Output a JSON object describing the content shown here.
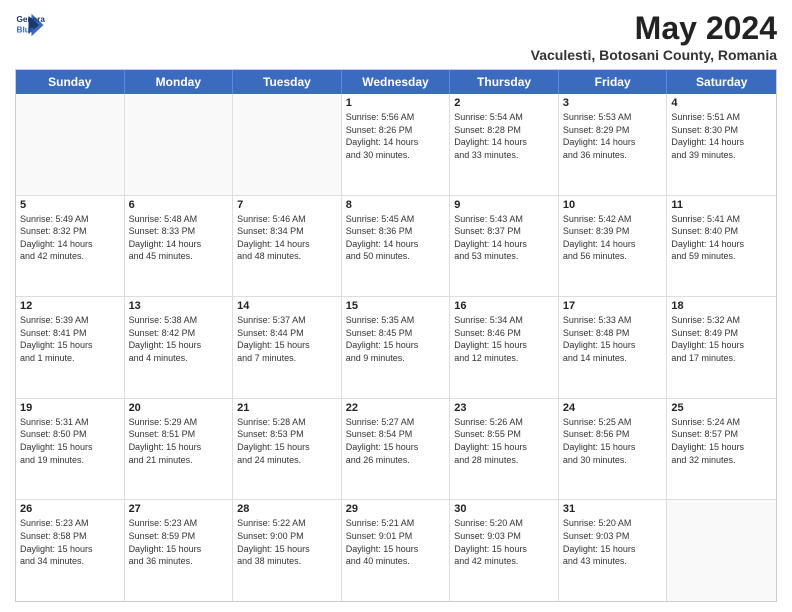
{
  "logo": {
    "line1": "General",
    "line2": "Blue"
  },
  "title": "May 2024",
  "subtitle": "Vaculesti, Botosani County, Romania",
  "header_days": [
    "Sunday",
    "Monday",
    "Tuesday",
    "Wednesday",
    "Thursday",
    "Friday",
    "Saturday"
  ],
  "weeks": [
    [
      {
        "day": "",
        "info": ""
      },
      {
        "day": "",
        "info": ""
      },
      {
        "day": "",
        "info": ""
      },
      {
        "day": "1",
        "info": "Sunrise: 5:56 AM\nSunset: 8:26 PM\nDaylight: 14 hours\nand 30 minutes."
      },
      {
        "day": "2",
        "info": "Sunrise: 5:54 AM\nSunset: 8:28 PM\nDaylight: 14 hours\nand 33 minutes."
      },
      {
        "day": "3",
        "info": "Sunrise: 5:53 AM\nSunset: 8:29 PM\nDaylight: 14 hours\nand 36 minutes."
      },
      {
        "day": "4",
        "info": "Sunrise: 5:51 AM\nSunset: 8:30 PM\nDaylight: 14 hours\nand 39 minutes."
      }
    ],
    [
      {
        "day": "5",
        "info": "Sunrise: 5:49 AM\nSunset: 8:32 PM\nDaylight: 14 hours\nand 42 minutes."
      },
      {
        "day": "6",
        "info": "Sunrise: 5:48 AM\nSunset: 8:33 PM\nDaylight: 14 hours\nand 45 minutes."
      },
      {
        "day": "7",
        "info": "Sunrise: 5:46 AM\nSunset: 8:34 PM\nDaylight: 14 hours\nand 48 minutes."
      },
      {
        "day": "8",
        "info": "Sunrise: 5:45 AM\nSunset: 8:36 PM\nDaylight: 14 hours\nand 50 minutes."
      },
      {
        "day": "9",
        "info": "Sunrise: 5:43 AM\nSunset: 8:37 PM\nDaylight: 14 hours\nand 53 minutes."
      },
      {
        "day": "10",
        "info": "Sunrise: 5:42 AM\nSunset: 8:39 PM\nDaylight: 14 hours\nand 56 minutes."
      },
      {
        "day": "11",
        "info": "Sunrise: 5:41 AM\nSunset: 8:40 PM\nDaylight: 14 hours\nand 59 minutes."
      }
    ],
    [
      {
        "day": "12",
        "info": "Sunrise: 5:39 AM\nSunset: 8:41 PM\nDaylight: 15 hours\nand 1 minute."
      },
      {
        "day": "13",
        "info": "Sunrise: 5:38 AM\nSunset: 8:42 PM\nDaylight: 15 hours\nand 4 minutes."
      },
      {
        "day": "14",
        "info": "Sunrise: 5:37 AM\nSunset: 8:44 PM\nDaylight: 15 hours\nand 7 minutes."
      },
      {
        "day": "15",
        "info": "Sunrise: 5:35 AM\nSunset: 8:45 PM\nDaylight: 15 hours\nand 9 minutes."
      },
      {
        "day": "16",
        "info": "Sunrise: 5:34 AM\nSunset: 8:46 PM\nDaylight: 15 hours\nand 12 minutes."
      },
      {
        "day": "17",
        "info": "Sunrise: 5:33 AM\nSunset: 8:48 PM\nDaylight: 15 hours\nand 14 minutes."
      },
      {
        "day": "18",
        "info": "Sunrise: 5:32 AM\nSunset: 8:49 PM\nDaylight: 15 hours\nand 17 minutes."
      }
    ],
    [
      {
        "day": "19",
        "info": "Sunrise: 5:31 AM\nSunset: 8:50 PM\nDaylight: 15 hours\nand 19 minutes."
      },
      {
        "day": "20",
        "info": "Sunrise: 5:29 AM\nSunset: 8:51 PM\nDaylight: 15 hours\nand 21 minutes."
      },
      {
        "day": "21",
        "info": "Sunrise: 5:28 AM\nSunset: 8:53 PM\nDaylight: 15 hours\nand 24 minutes."
      },
      {
        "day": "22",
        "info": "Sunrise: 5:27 AM\nSunset: 8:54 PM\nDaylight: 15 hours\nand 26 minutes."
      },
      {
        "day": "23",
        "info": "Sunrise: 5:26 AM\nSunset: 8:55 PM\nDaylight: 15 hours\nand 28 minutes."
      },
      {
        "day": "24",
        "info": "Sunrise: 5:25 AM\nSunset: 8:56 PM\nDaylight: 15 hours\nand 30 minutes."
      },
      {
        "day": "25",
        "info": "Sunrise: 5:24 AM\nSunset: 8:57 PM\nDaylight: 15 hours\nand 32 minutes."
      }
    ],
    [
      {
        "day": "26",
        "info": "Sunrise: 5:23 AM\nSunset: 8:58 PM\nDaylight: 15 hours\nand 34 minutes."
      },
      {
        "day": "27",
        "info": "Sunrise: 5:23 AM\nSunset: 8:59 PM\nDaylight: 15 hours\nand 36 minutes."
      },
      {
        "day": "28",
        "info": "Sunrise: 5:22 AM\nSunset: 9:00 PM\nDaylight: 15 hours\nand 38 minutes."
      },
      {
        "day": "29",
        "info": "Sunrise: 5:21 AM\nSunset: 9:01 PM\nDaylight: 15 hours\nand 40 minutes."
      },
      {
        "day": "30",
        "info": "Sunrise: 5:20 AM\nSunset: 9:03 PM\nDaylight: 15 hours\nand 42 minutes."
      },
      {
        "day": "31",
        "info": "Sunrise: 5:20 AM\nSunset: 9:03 PM\nDaylight: 15 hours\nand 43 minutes."
      },
      {
        "day": "",
        "info": ""
      }
    ]
  ]
}
